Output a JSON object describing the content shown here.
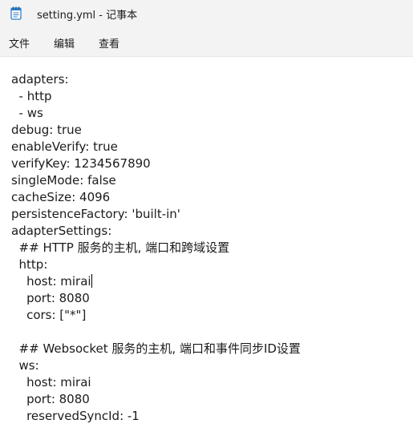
{
  "window": {
    "title": "setting.yml - 记事本",
    "icon": "notepad-icon"
  },
  "menu": {
    "file": "文件",
    "edit": "编辑",
    "view": "查看"
  },
  "editor": {
    "lines": [
      "adapters:",
      "  - http",
      "  - ws",
      "debug: true",
      "enableVerify: true",
      "verifyKey: 1234567890",
      "singleMode: false",
      "cacheSize: 4096",
      "persistenceFactory: 'built-in'",
      "adapterSettings:",
      "  ## HTTP 服务的主机, 端口和跨域设置",
      "  http:",
      "    host: mirai",
      "    port: 8080",
      "    cors: [\"*\"]",
      "",
      "  ## Websocket 服务的主机, 端口和事件同步ID设置",
      "  ws:",
      "    host: mirai",
      "    port: 8080",
      "    reservedSyncId: -1"
    ]
  }
}
